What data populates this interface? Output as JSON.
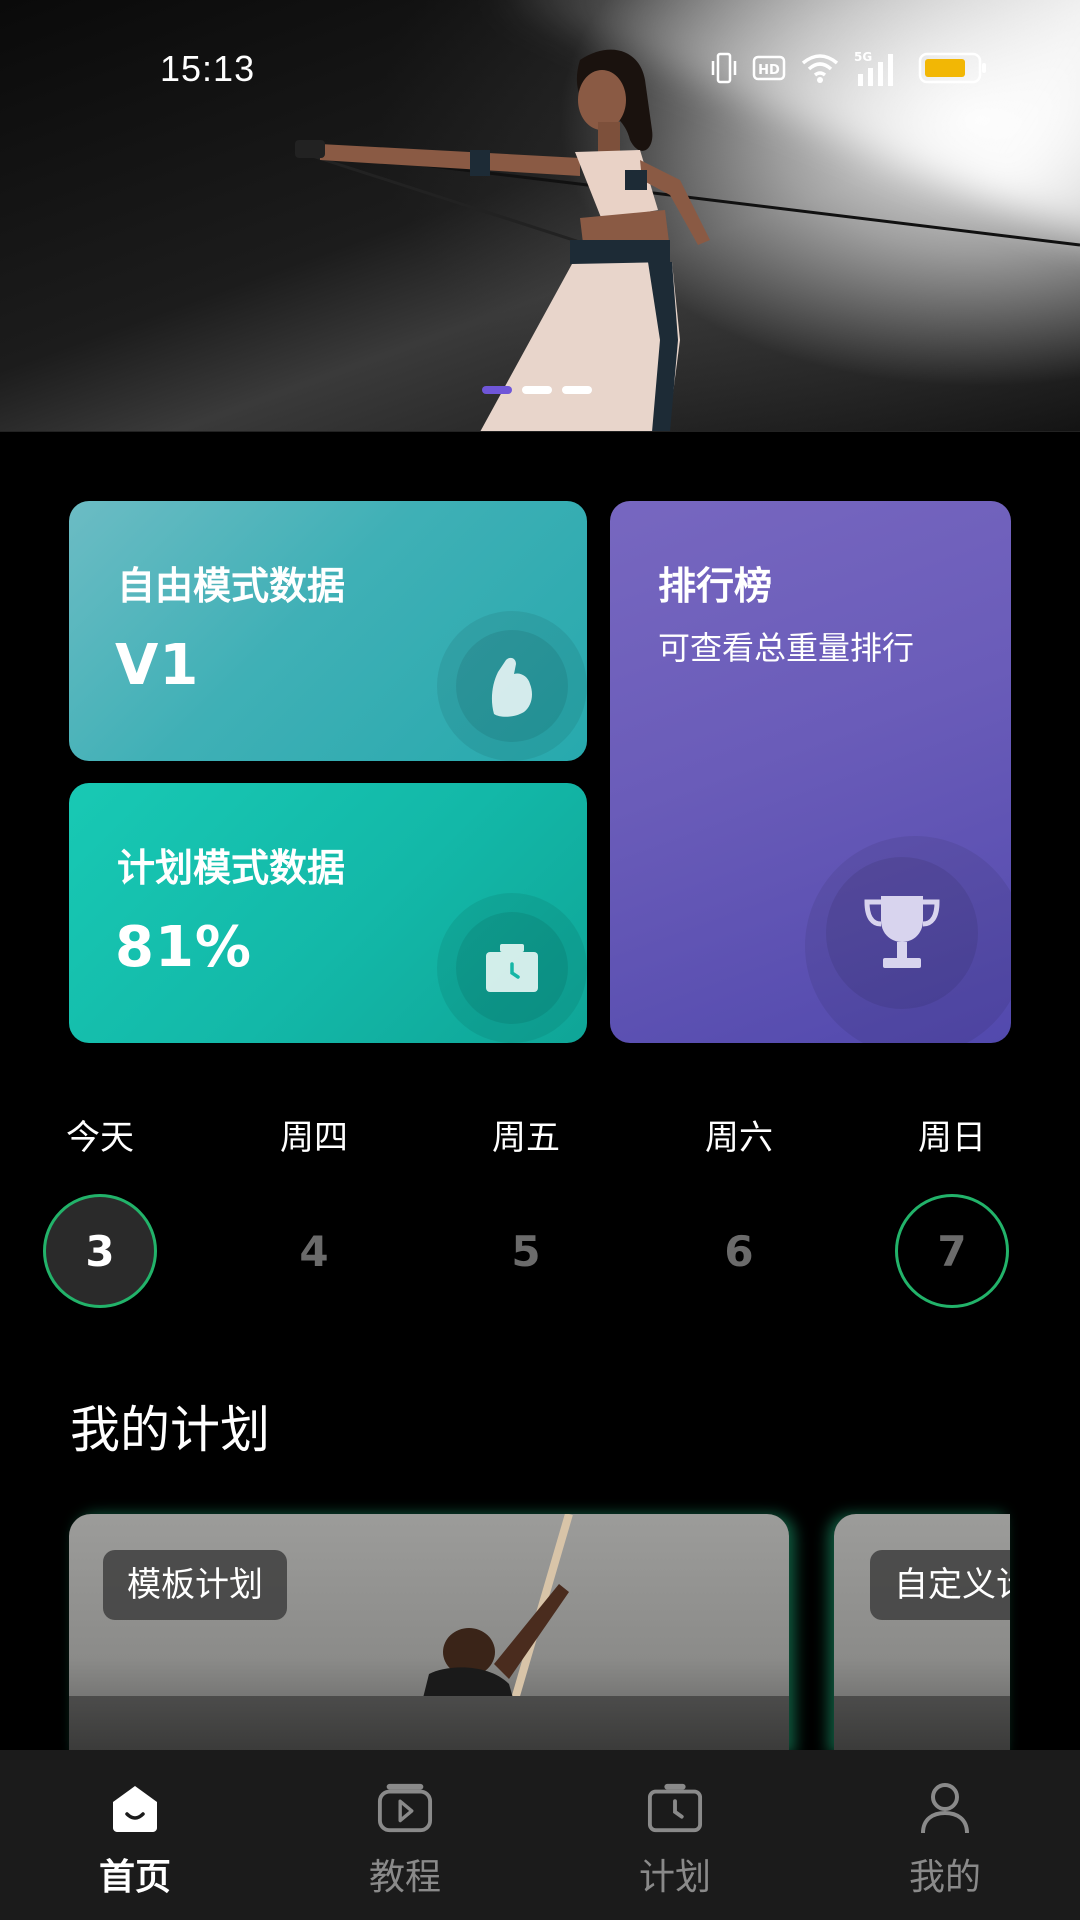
{
  "status_bar": {
    "time": "15:13",
    "network": "5G",
    "icons": [
      "vibrate-icon",
      "hd-icon",
      "wifi-icon",
      "signal-icon",
      "battery-icon"
    ]
  },
  "banner": {
    "slides": 3,
    "active_slide": 0,
    "accent": "#6f56d8"
  },
  "cards": {
    "free_mode": {
      "title": "自由模式数据",
      "value": "V1",
      "icon": "flexed-arm-icon"
    },
    "plan_mode": {
      "title": "计划模式数据",
      "value": "81%",
      "icon": "clipboard-clock-icon"
    },
    "ranking": {
      "title": "排行榜",
      "subtitle": "可查看总重量排行",
      "icon": "trophy-icon"
    }
  },
  "week": {
    "days": [
      {
        "label": "今天",
        "date": "3",
        "state": "today"
      },
      {
        "label": "周四",
        "date": "4",
        "state": "normal"
      },
      {
        "label": "周五",
        "date": "5",
        "state": "normal"
      },
      {
        "label": "周六",
        "date": "6",
        "state": "normal"
      },
      {
        "label": "周日",
        "date": "7",
        "state": "ring"
      }
    ],
    "accent": "#22b36a"
  },
  "my_plan": {
    "title": "我的计划",
    "items": [
      {
        "tag": "模板计划"
      },
      {
        "tag": "自定义计"
      }
    ]
  },
  "bottom_nav": {
    "items": [
      {
        "label": "首页",
        "icon": "home-icon",
        "active": true
      },
      {
        "label": "教程",
        "icon": "tutorial-play-icon",
        "active": false
      },
      {
        "label": "计划",
        "icon": "calendar-clock-icon",
        "active": false
      },
      {
        "label": "我的",
        "icon": "profile-icon",
        "active": false
      }
    ]
  }
}
